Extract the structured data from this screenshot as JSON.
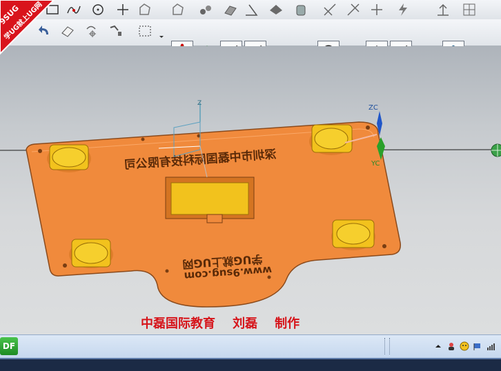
{
  "window": {
    "badge_line1": "9SUG",
    "badge_line2": "学UG就上UG网"
  },
  "toolbar_top": {
    "icons": [
      "rectangle-icon",
      "spline-icon",
      "circle-icon",
      "point-icon",
      "sketch-icon",
      "sketch-icon",
      "chain-icon",
      "extrude-icon",
      "draft-icon",
      "shape-icon",
      "cylinder-icon",
      "trim-icon",
      "trim-icon",
      "trim-icon",
      "lightning-icon",
      "align-icon",
      "grid-icon"
    ]
  },
  "toolbar_main": {
    "icons": [
      "undo-icon",
      "eraser-icon",
      "rotate-view-icon",
      "snap-view-icon",
      "select-box-icon",
      "snap-points-icon",
      "snap-settings-icon",
      "line-icon",
      "line-point-icon",
      "arc-icon",
      "arc-center-icon",
      "point-circle-icon",
      "circle-icon",
      "cross-icon",
      "tangent-line-icon",
      "blend-icon",
      "solid-cube-icon"
    ]
  },
  "viewport": {
    "axis_labels": {
      "z": "Z",
      "zc": "ZC",
      "yc": "YC"
    },
    "part_text_top": "深圳市中磊国际科技有限公司",
    "part_text_bottom_1": "学UG就上UG网",
    "part_text_bottom_2": "www.9sug.com",
    "colors": {
      "part_body": "#f08a3c",
      "pad": "#f2c21d",
      "background_top": "#aeb4bb",
      "background_bottom": "#dcdedf"
    }
  },
  "caption": {
    "org": "中磊国际教育",
    "author": "刘磊",
    "made": "制作"
  },
  "taskbar": {
    "start_label": "DF",
    "tray_icons": [
      "up-arrow-icon",
      "user-icon",
      "smiley-icon",
      "flag-icon",
      "signal-icon"
    ]
  }
}
